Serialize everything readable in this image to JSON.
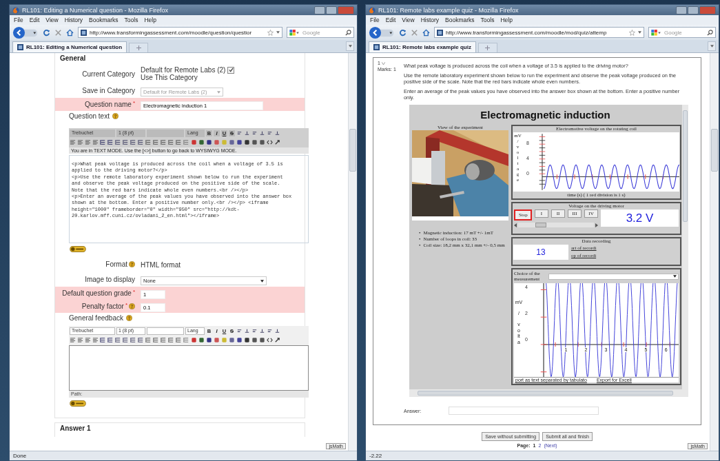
{
  "left_window": {
    "title": "RL101: Editing a Numerical question - Mozilla Firefox",
    "menu": [
      "File",
      "Edit",
      "View",
      "History",
      "Bookmarks",
      "Tools",
      "Help"
    ],
    "url": "http://www.transformingassessment.com/moodle/question/questior",
    "search": {
      "placeholder": "Google"
    },
    "tabs": [
      {
        "label": "RL101: Editing a Numerical question",
        "selected": true
      }
    ],
    "status": "Done",
    "status_badge": "jsMath"
  },
  "edit_form": {
    "section": "General",
    "fields": [
      {
        "kind": "category",
        "label": "Current Category",
        "value": "Default for Remote Labs (2)",
        "checkbox_label": "Use This Category",
        "checked": true,
        "required": false,
        "help": false
      },
      {
        "kind": "select",
        "label": "Save in Category",
        "value": "Default for Remote Labs (2)",
        "disabled": true,
        "required": false,
        "help": false
      },
      {
        "kind": "text",
        "label": "Question name",
        "mark": "*",
        "value": "Electromagnetic induction 1",
        "required": true,
        "help": false
      },
      {
        "kind": "editor",
        "label": "Question text",
        "required": false,
        "help": true,
        "editor": {
          "toolbar_disabled": true,
          "font": "Trebuchet",
          "size": "1 (8 pt)",
          "lang": "Lang",
          "format_buttons": [
            "B",
            "I",
            "U",
            "S"
          ],
          "notice": "You are in TEXT MODE. Use the [<>] button to go back to WYSIWYG MODE.",
          "lines": [
            "<p>What peak voltage is produced across the coil when a voltage of 3.5 is",
            "applied to the driving motor?</p>",
            "<p>Use the remote laboratory experiment shown below to run the experiment",
            "and observe the peak voltage produced on the positive side of the scale.",
            "Note that the red bars indicate whole even numbers.<br /></p>",
            "<p>Enter an average of the peak values you have observed into the answer box",
            "shown at the bottom. Enter a positive number only.<br /></p> <iframe",
            "height=\"1000\" frameborder=\"0\" width=\"950\" src=\"http://kdt-",
            "20.karlov.mff.cuni.cz/ovladani_2_en.html\"></iframe>"
          ]
        }
      },
      {
        "kind": "static",
        "label": "Format",
        "value": "HTML format",
        "required": false,
        "help": true
      },
      {
        "kind": "select",
        "label": "Image to display",
        "value": "None",
        "disabled": false,
        "required": false,
        "help": false
      },
      {
        "kind": "text",
        "label": "Default question grade",
        "mark": "*",
        "value": "1",
        "required": true,
        "help": false
      },
      {
        "kind": "text",
        "label": "Penalty factor",
        "mark": "*",
        "value": "0.1",
        "required": true,
        "help": true
      },
      {
        "kind": "editor",
        "label": "General feedback",
        "required": false,
        "help": true,
        "editor": {
          "toolbar_disabled": false,
          "font": "Trebuchet",
          "size": "1 (8 pt)",
          "lang": "Lang",
          "format_buttons": [
            "B",
            "I",
            "U",
            "S"
          ],
          "path": "Path:"
        }
      }
    ],
    "next_section": "Answer 1"
  },
  "right_window": {
    "title": "RL101: Remote labs example quiz - Mozilla Firefox",
    "menu": [
      "File",
      "Edit",
      "View",
      "History",
      "Bookmarks",
      "Tools",
      "Help"
    ],
    "url": "http://www.transformingassessment.com/moodle/mod/quiz/attemp",
    "search": {
      "placeholder": "Google"
    },
    "tabs": [
      {
        "label": "RL101: Remote labs example quiz",
        "selected": true
      }
    ],
    "status": "-2.22",
    "status_badge": "jsMath"
  },
  "quiz": {
    "number": "1",
    "marks": "Marks: 1",
    "paragraphs": [
      "What peak voltage is produced across the coil when a voltage of 3.5 is applied to the driving motor?",
      "Use the remote laboratory experiment shown below to run the experiment and observe the peak voltage produced on the positive side of the scale. Note that the red bars indicate whole even numbers.",
      "Enter an average of the peak values you have observed into the answer box shown at the bottom. Enter a positive number only."
    ],
    "lab": {
      "title": "Electromagnetic induction",
      "camera_caption": "View of the experiment",
      "facts": [
        {
          "bullet": "•",
          "text": "Magnetic induction: 17 mT +/- 1mT"
        },
        {
          "bullet": "•",
          "text": "Number of loops in coil: 33"
        },
        {
          "bullet": "•",
          "text": "Coil size: 18,2 mm x 32,1 mm +/- 0,5 mm"
        }
      ],
      "emf_panel": {
        "title": "Electromotive voltage on the rotating coil",
        "y_unit": "mV",
        "y_sep": "/",
        "y_label": "voltage",
        "y_ticks": [
          "8",
          "4",
          "0"
        ],
        "x_label": "time (s) ( 1 red division is 1 s)"
      },
      "motor_panel": {
        "title": "Voltage on the driving motor",
        "buttons": [
          {
            "label": "Stop",
            "selected": true
          },
          {
            "label": "I",
            "selected": false
          },
          {
            "label": "II",
            "selected": false
          },
          {
            "label": "III",
            "selected": false
          },
          {
            "label": "IV",
            "selected": false
          }
        ],
        "reading": "3.2 V",
        "slider": {
          "level": 0.3
        }
      },
      "recording_panel": {
        "title": "Data recording",
        "count": "13",
        "links": [
          "art of recordi",
          "op of recordi"
        ]
      },
      "measurement_panel": {
        "label": "Choice of the measurement",
        "y_unit": "mV",
        "y_sep": "/",
        "y_label": "volta",
        "y_ticks": [
          "4",
          "2",
          "0"
        ],
        "x_ticks": [
          "1",
          "2",
          "3",
          "4",
          "5",
          "6"
        ],
        "links": [
          "port as text separated by tabulato",
          "Export for Excell"
        ]
      }
    },
    "answer": {
      "label": "Answer:"
    },
    "buttons": [
      "Save without submitting",
      "Submit all and finish"
    ],
    "pages": {
      "label": "Page:",
      "items": [
        {
          "label": "1",
          "selected": true
        },
        {
          "label": "2",
          "selected": false
        }
      ],
      "next": "(Next)"
    }
  }
}
